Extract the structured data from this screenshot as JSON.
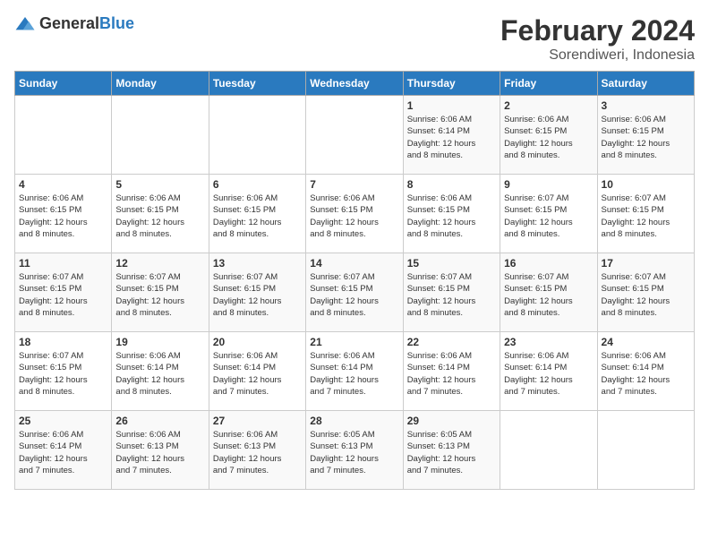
{
  "header": {
    "logo_general": "General",
    "logo_blue": "Blue",
    "title": "February 2024",
    "subtitle": "Sorendiweri, Indonesia"
  },
  "calendar": {
    "days_of_week": [
      "Sunday",
      "Monday",
      "Tuesday",
      "Wednesday",
      "Thursday",
      "Friday",
      "Saturday"
    ],
    "weeks": [
      [
        {
          "day": "",
          "info": ""
        },
        {
          "day": "",
          "info": ""
        },
        {
          "day": "",
          "info": ""
        },
        {
          "day": "",
          "info": ""
        },
        {
          "day": "1",
          "info": "Sunrise: 6:06 AM\nSunset: 6:14 PM\nDaylight: 12 hours\nand 8 minutes."
        },
        {
          "day": "2",
          "info": "Sunrise: 6:06 AM\nSunset: 6:15 PM\nDaylight: 12 hours\nand 8 minutes."
        },
        {
          "day": "3",
          "info": "Sunrise: 6:06 AM\nSunset: 6:15 PM\nDaylight: 12 hours\nand 8 minutes."
        }
      ],
      [
        {
          "day": "4",
          "info": "Sunrise: 6:06 AM\nSunset: 6:15 PM\nDaylight: 12 hours\nand 8 minutes."
        },
        {
          "day": "5",
          "info": "Sunrise: 6:06 AM\nSunset: 6:15 PM\nDaylight: 12 hours\nand 8 minutes."
        },
        {
          "day": "6",
          "info": "Sunrise: 6:06 AM\nSunset: 6:15 PM\nDaylight: 12 hours\nand 8 minutes."
        },
        {
          "day": "7",
          "info": "Sunrise: 6:06 AM\nSunset: 6:15 PM\nDaylight: 12 hours\nand 8 minutes."
        },
        {
          "day": "8",
          "info": "Sunrise: 6:06 AM\nSunset: 6:15 PM\nDaylight: 12 hours\nand 8 minutes."
        },
        {
          "day": "9",
          "info": "Sunrise: 6:07 AM\nSunset: 6:15 PM\nDaylight: 12 hours\nand 8 minutes."
        },
        {
          "day": "10",
          "info": "Sunrise: 6:07 AM\nSunset: 6:15 PM\nDaylight: 12 hours\nand 8 minutes."
        }
      ],
      [
        {
          "day": "11",
          "info": "Sunrise: 6:07 AM\nSunset: 6:15 PM\nDaylight: 12 hours\nand 8 minutes."
        },
        {
          "day": "12",
          "info": "Sunrise: 6:07 AM\nSunset: 6:15 PM\nDaylight: 12 hours\nand 8 minutes."
        },
        {
          "day": "13",
          "info": "Sunrise: 6:07 AM\nSunset: 6:15 PM\nDaylight: 12 hours\nand 8 minutes."
        },
        {
          "day": "14",
          "info": "Sunrise: 6:07 AM\nSunset: 6:15 PM\nDaylight: 12 hours\nand 8 minutes."
        },
        {
          "day": "15",
          "info": "Sunrise: 6:07 AM\nSunset: 6:15 PM\nDaylight: 12 hours\nand 8 minutes."
        },
        {
          "day": "16",
          "info": "Sunrise: 6:07 AM\nSunset: 6:15 PM\nDaylight: 12 hours\nand 8 minutes."
        },
        {
          "day": "17",
          "info": "Sunrise: 6:07 AM\nSunset: 6:15 PM\nDaylight: 12 hours\nand 8 minutes."
        }
      ],
      [
        {
          "day": "18",
          "info": "Sunrise: 6:07 AM\nSunset: 6:15 PM\nDaylight: 12 hours\nand 8 minutes."
        },
        {
          "day": "19",
          "info": "Sunrise: 6:06 AM\nSunset: 6:14 PM\nDaylight: 12 hours\nand 8 minutes."
        },
        {
          "day": "20",
          "info": "Sunrise: 6:06 AM\nSunset: 6:14 PM\nDaylight: 12 hours\nand 7 minutes."
        },
        {
          "day": "21",
          "info": "Sunrise: 6:06 AM\nSunset: 6:14 PM\nDaylight: 12 hours\nand 7 minutes."
        },
        {
          "day": "22",
          "info": "Sunrise: 6:06 AM\nSunset: 6:14 PM\nDaylight: 12 hours\nand 7 minutes."
        },
        {
          "day": "23",
          "info": "Sunrise: 6:06 AM\nSunset: 6:14 PM\nDaylight: 12 hours\nand 7 minutes."
        },
        {
          "day": "24",
          "info": "Sunrise: 6:06 AM\nSunset: 6:14 PM\nDaylight: 12 hours\nand 7 minutes."
        }
      ],
      [
        {
          "day": "25",
          "info": "Sunrise: 6:06 AM\nSunset: 6:14 PM\nDaylight: 12 hours\nand 7 minutes."
        },
        {
          "day": "26",
          "info": "Sunrise: 6:06 AM\nSunset: 6:13 PM\nDaylight: 12 hours\nand 7 minutes."
        },
        {
          "day": "27",
          "info": "Sunrise: 6:06 AM\nSunset: 6:13 PM\nDaylight: 12 hours\nand 7 minutes."
        },
        {
          "day": "28",
          "info": "Sunrise: 6:05 AM\nSunset: 6:13 PM\nDaylight: 12 hours\nand 7 minutes."
        },
        {
          "day": "29",
          "info": "Sunrise: 6:05 AM\nSunset: 6:13 PM\nDaylight: 12 hours\nand 7 minutes."
        },
        {
          "day": "",
          "info": ""
        },
        {
          "day": "",
          "info": ""
        }
      ]
    ]
  }
}
